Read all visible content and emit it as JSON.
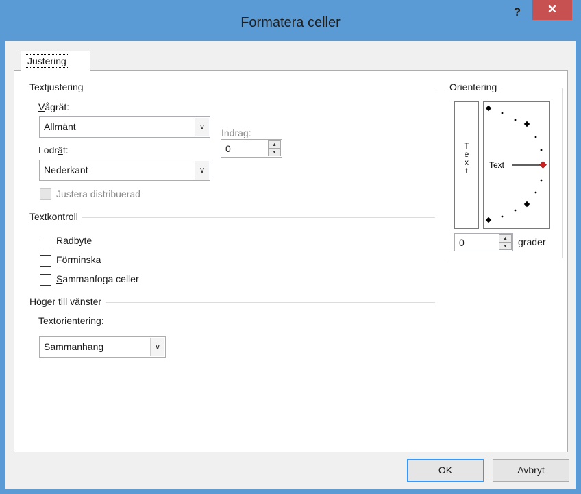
{
  "window": {
    "title": "Formatera celler",
    "help": "?",
    "close": "✕"
  },
  "tabs": [
    {
      "label": "Justering"
    }
  ],
  "text_alignment": {
    "group_title": "Textjustering",
    "horizontal_label_pre": "",
    "horizontal_label_u": "V",
    "horizontal_label_post": "ågrät:",
    "horizontal_value": "Allmänt",
    "indent_label": "Indrag:",
    "indent_value": "0",
    "vertical_label_pre": "Lodr",
    "vertical_label_u": "ä",
    "vertical_label_post": "t:",
    "vertical_value": "Nederkant",
    "justify_distributed": "Justera distribuerad"
  },
  "text_control": {
    "group_title": "Textkontroll",
    "wrap_pre": "Rad",
    "wrap_u": "b",
    "wrap_post": "yte",
    "shrink_pre": "",
    "shrink_u": "F",
    "shrink_post": "örminska",
    "merge_pre": "",
    "merge_u": "S",
    "merge_post": "ammanfoga celler"
  },
  "rtl": {
    "group_title": "Höger till vänster",
    "direction_label_pre": "Te",
    "direction_label_u": "x",
    "direction_label_post": "torientering:",
    "direction_value": "Sammanhang"
  },
  "orientation": {
    "group_title": "Orientering",
    "vertical_letters": [
      "T",
      "e",
      "x",
      "t"
    ],
    "dial_label": "Text",
    "degrees_value": "0",
    "degrees_label_pre": "",
    "degrees_label_u": "g",
    "degrees_label_post": "rader"
  },
  "buttons": {
    "ok": "OK",
    "cancel": "Avbryt"
  },
  "icons": {
    "dropdown": "chevron-down-icon",
    "spin_up": "triangle-up-icon",
    "spin_down": "triangle-down-icon"
  },
  "colors": {
    "titlebar": "#5b9bd5",
    "close_button": "#c75050",
    "dial_marker": "#d02020",
    "default_button_border": "#3399ff"
  }
}
